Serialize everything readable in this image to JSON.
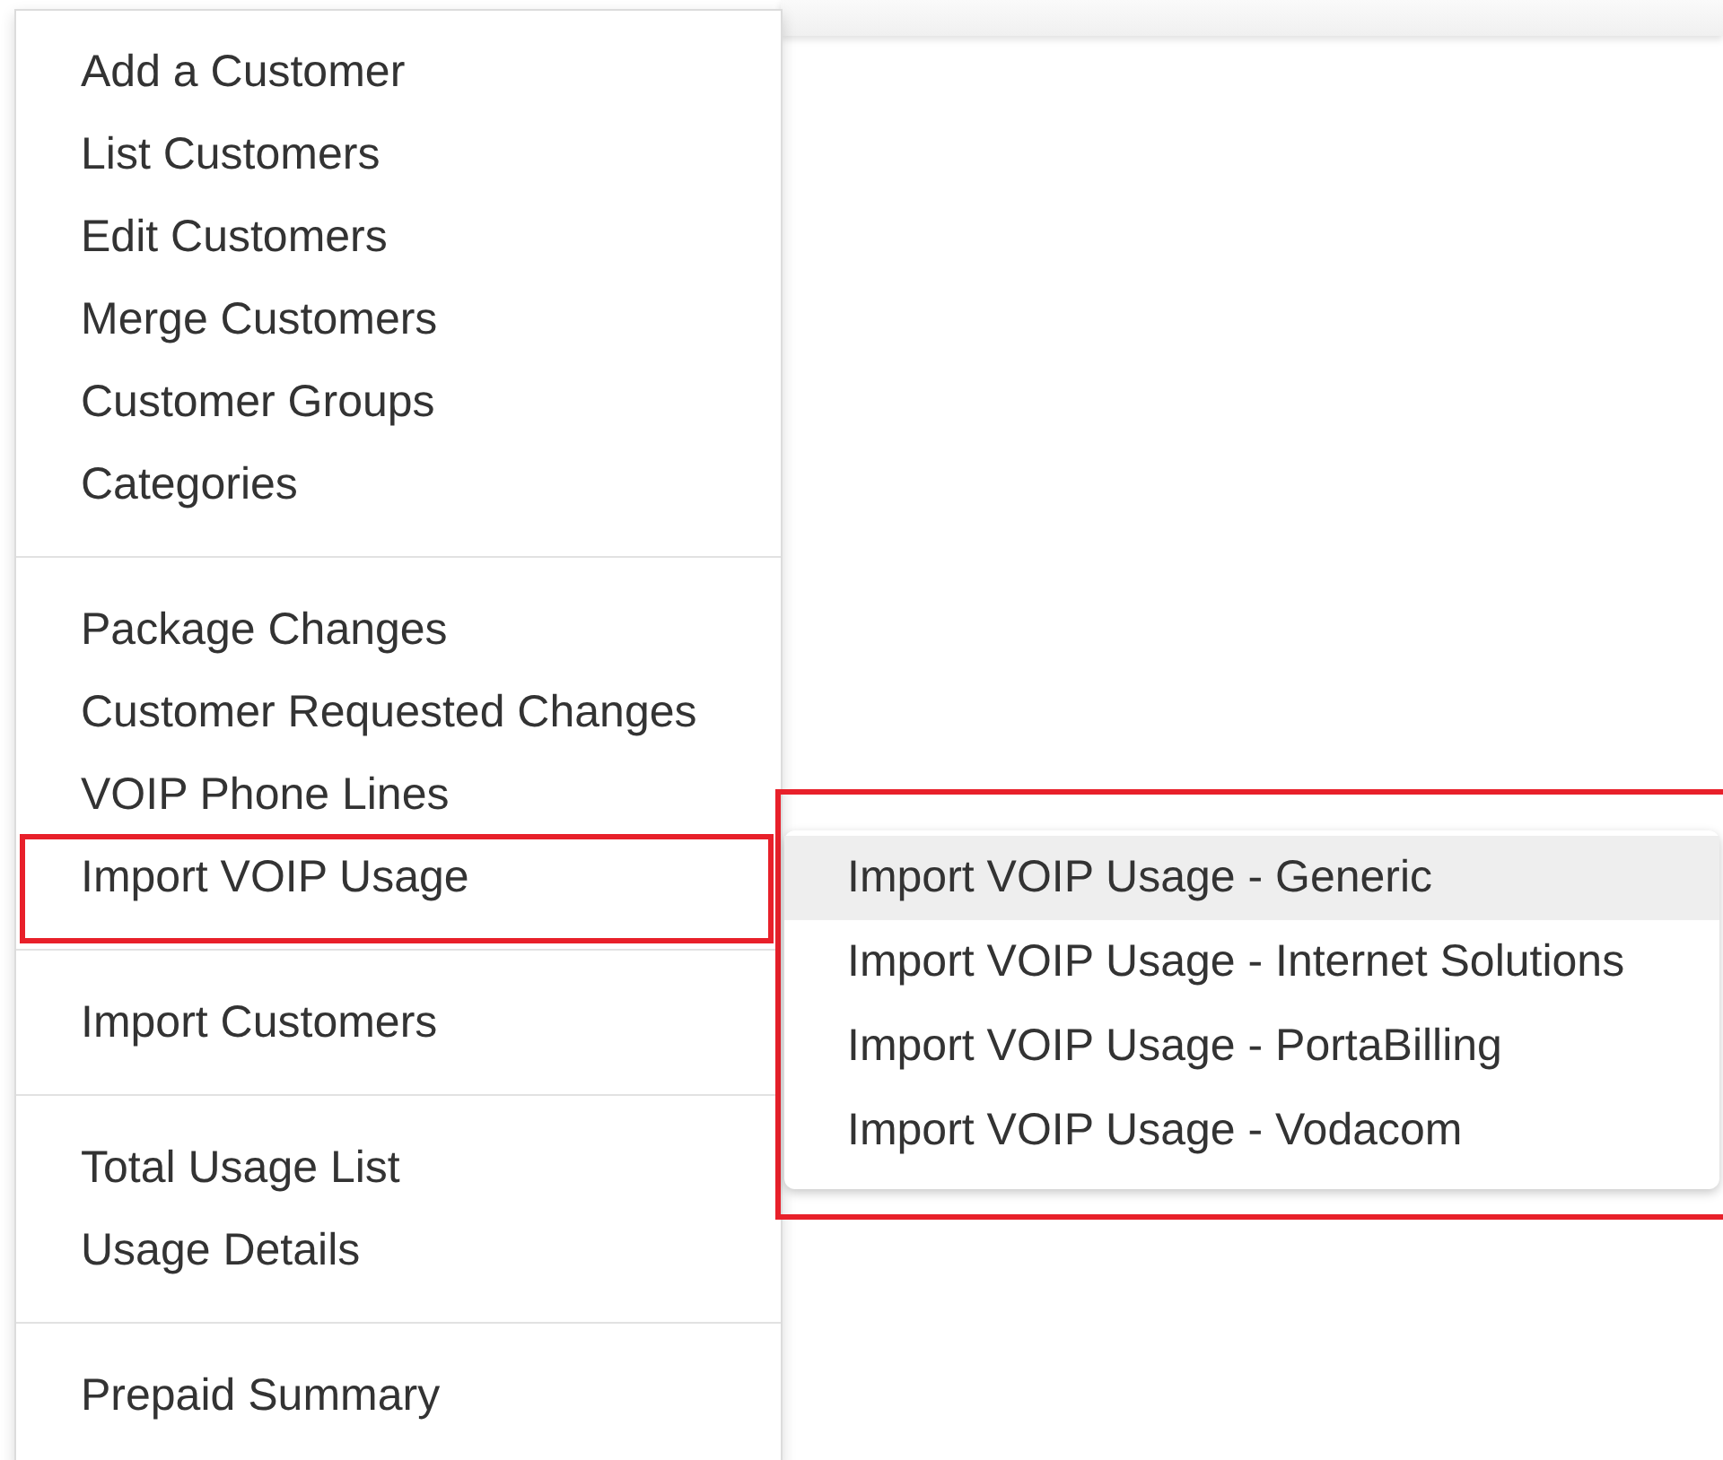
{
  "menu": {
    "sections": [
      {
        "items": [
          {
            "label": "Add a Customer"
          },
          {
            "label": "List Customers"
          },
          {
            "label": "Edit Customers"
          },
          {
            "label": "Merge Customers"
          },
          {
            "label": "Customer Groups"
          },
          {
            "label": "Categories"
          }
        ]
      },
      {
        "items": [
          {
            "label": "Package Changes"
          },
          {
            "label": "Customer Requested Changes"
          },
          {
            "label": "VOIP Phone Lines"
          },
          {
            "label": "Import VOIP Usage",
            "expanded": true,
            "children": [
              {
                "label": "Import VOIP Usage - Generic",
                "selected": true
              },
              {
                "label": "Import VOIP Usage - Internet Solutions",
                "selected": false
              },
              {
                "label": "Import VOIP Usage - PortaBilling",
                "selected": false
              },
              {
                "label": "Import VOIP Usage - Vodacom",
                "selected": false
              }
            ]
          }
        ]
      },
      {
        "items": [
          {
            "label": "Import Customers"
          }
        ]
      },
      {
        "items": [
          {
            "label": "Total Usage List"
          },
          {
            "label": "Usage Details"
          }
        ]
      },
      {
        "items": [
          {
            "label": "Prepaid Summary"
          }
        ]
      }
    ]
  }
}
